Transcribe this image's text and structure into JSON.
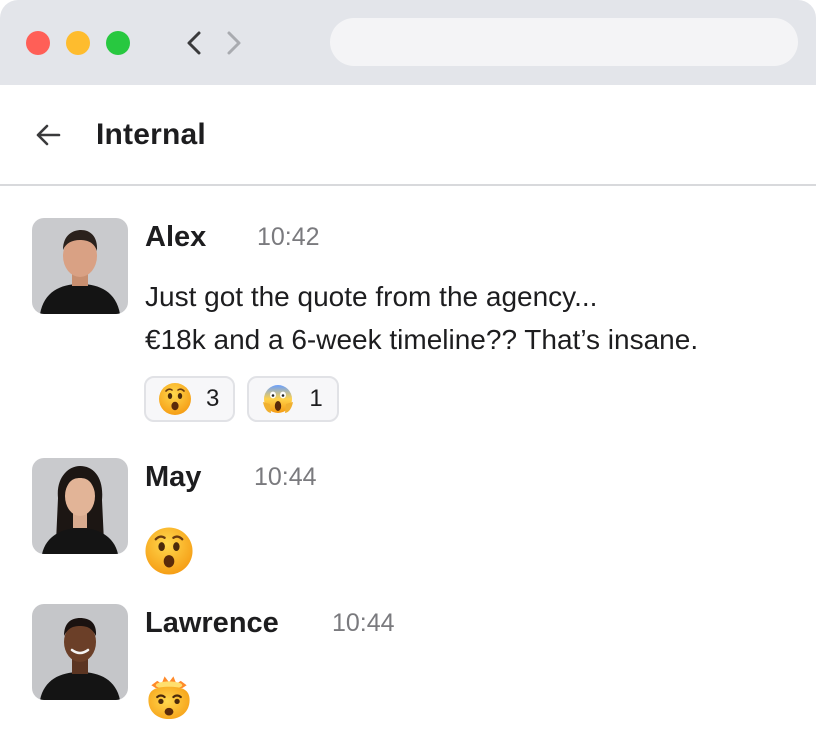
{
  "window": {
    "controls": [
      "close",
      "minimize",
      "zoom"
    ],
    "nav_icons": [
      "chevron-left-icon",
      "chevron-right-icon"
    ],
    "address_value": ""
  },
  "header": {
    "back_icon": "arrow-left-icon",
    "title": "Internal"
  },
  "messages": [
    {
      "author": "Alex",
      "time": "10:42",
      "lines": [
        "Just got the quote from the agency...",
        "€18k and a 6-week timeline?? That’s insane."
      ],
      "reactions": [
        {
          "emoji": "hushed-face-emoji",
          "count": "3"
        },
        {
          "emoji": "screaming-face-emoji",
          "count": "1"
        }
      ]
    },
    {
      "author": "May",
      "time": "10:44",
      "emoji": "hushed-face-emoji"
    },
    {
      "author": "Lawrence",
      "time": "10:44",
      "emoji": "exploding-head-emoji"
    }
  ],
  "colors": {
    "titlebar": "#e3e5ea",
    "close": "#ff5f57",
    "minimize": "#febc2e",
    "zoom": "#28c840",
    "text_primary": "#1d1d1f",
    "text_secondary": "#7a7a7e",
    "reaction_border": "#e1e2e6"
  }
}
